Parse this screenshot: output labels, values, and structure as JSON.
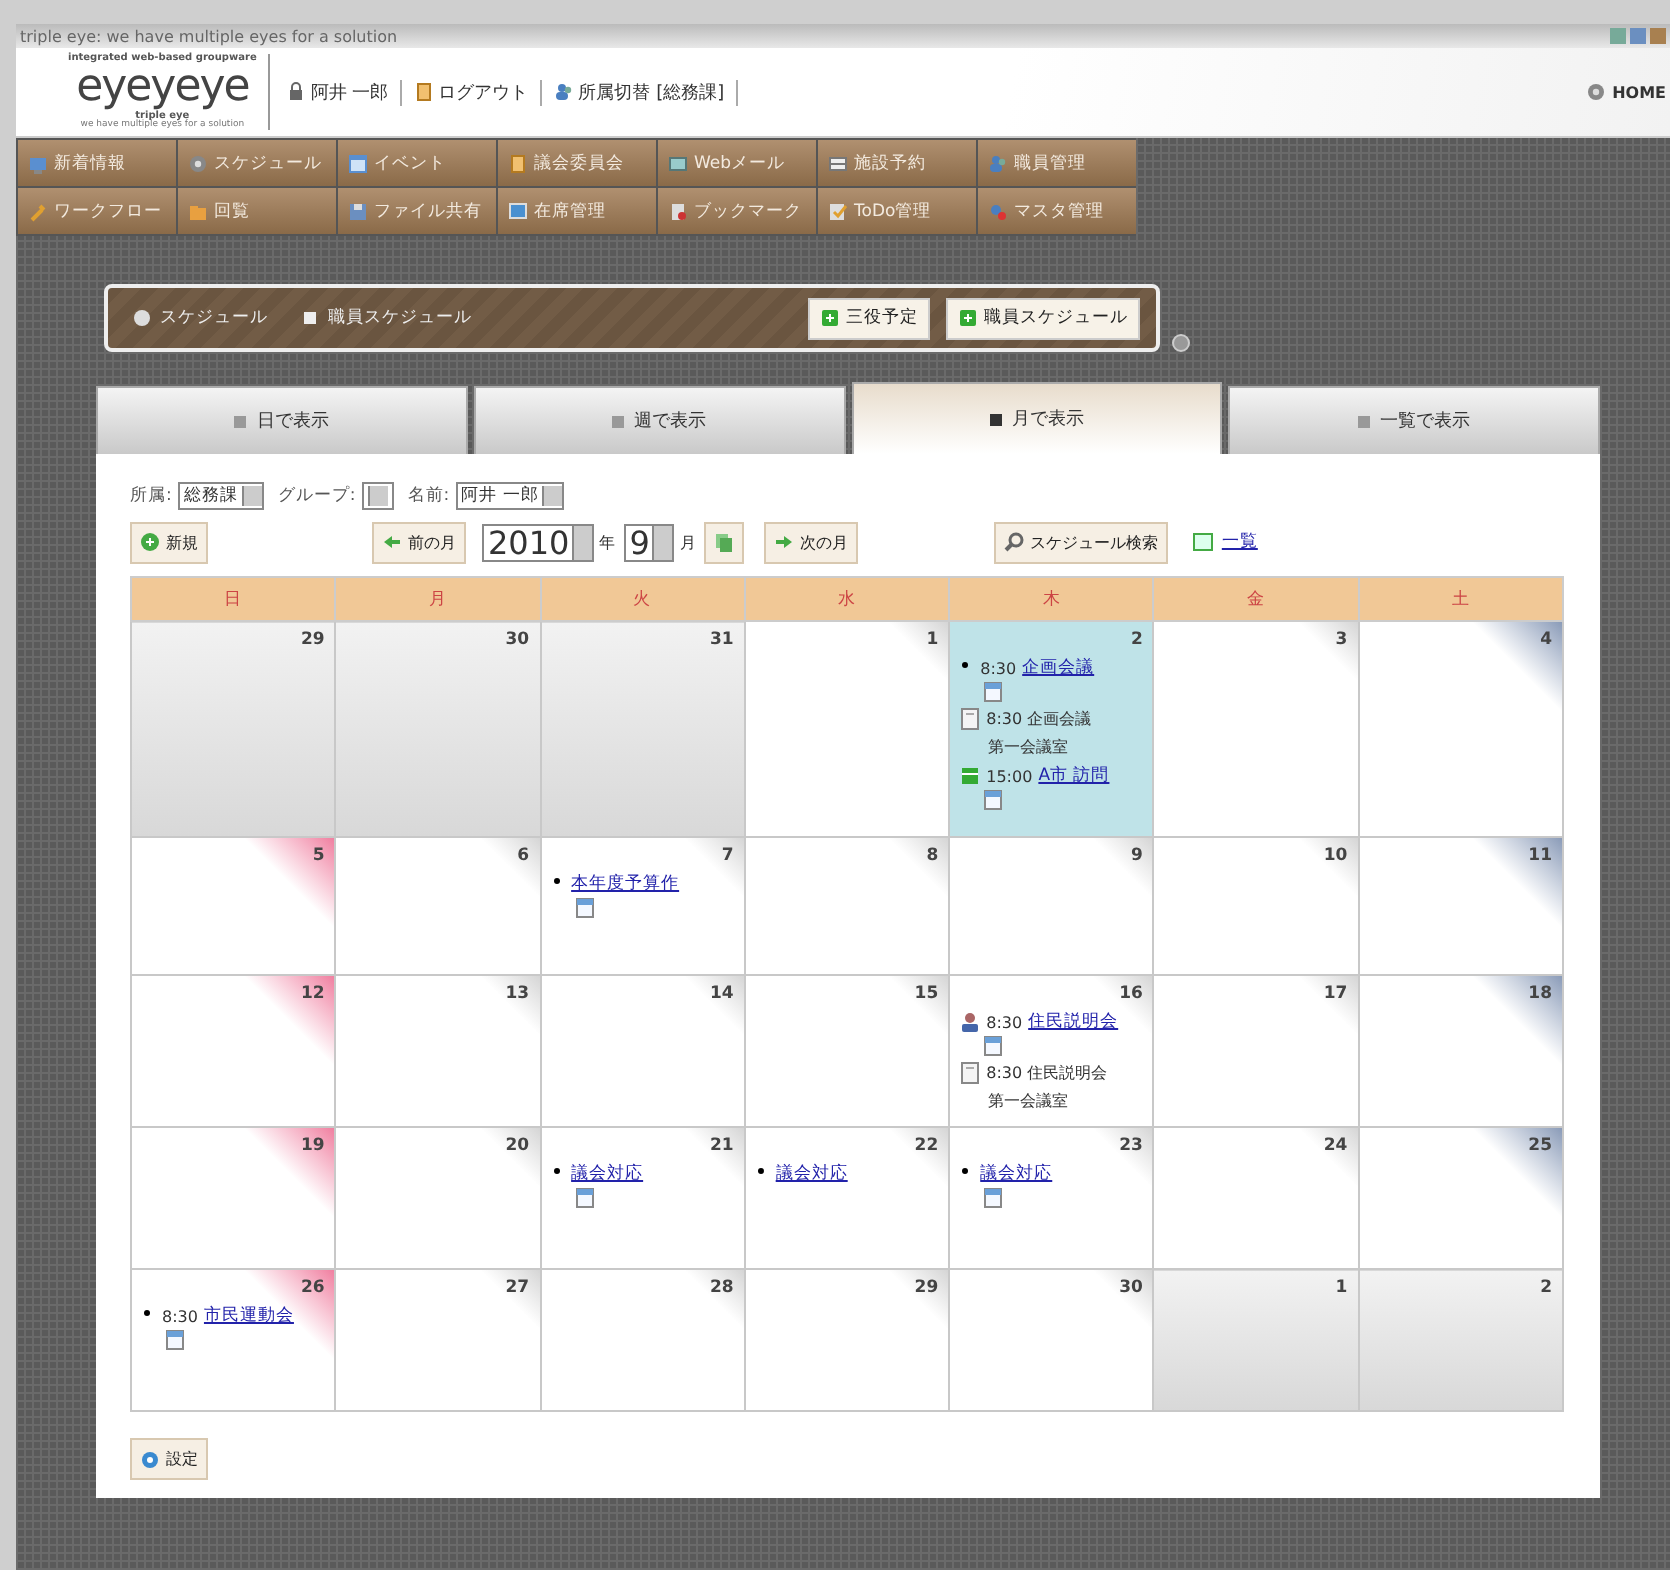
{
  "window": {
    "title": "triple eye: we have multiple eyes for a solution"
  },
  "header": {
    "logo": {
      "tagline_top": "integrated web-based groupware",
      "wordmark": "eyeyeye",
      "name": "triple eye",
      "tagline_bottom": "we have multiple eyes for a solution"
    },
    "user": "阿井 一郎",
    "logout": "ログアウト",
    "switch": "所属切替 [総務課]",
    "home": "HOME"
  },
  "menu": [
    [
      {
        "label": "新着情報"
      },
      {
        "label": "スケジュール"
      },
      {
        "label": "イベント"
      },
      {
        "label": "議会委員会"
      },
      {
        "label": "Webメール"
      },
      {
        "label": "施設予約"
      },
      {
        "label": "職員管理"
      }
    ],
    [
      {
        "label": "ワークフロー"
      },
      {
        "label": "回覧"
      },
      {
        "label": "ファイル共有"
      },
      {
        "label": "在席管理"
      },
      {
        "label": "ブックマーク"
      },
      {
        "label": "ToDo管理"
      },
      {
        "label": "マスタ管理"
      }
    ]
  ],
  "panel": {
    "links": [
      "スケジュール",
      "職員スケジュール"
    ],
    "buttons": [
      "三役予定",
      "職員スケジュール"
    ]
  },
  "tabs": [
    {
      "label": "日で表示",
      "selected": false
    },
    {
      "label": "週で表示",
      "selected": false
    },
    {
      "label": "月で表示",
      "selected": true
    },
    {
      "label": "一覧で表示",
      "selected": false
    }
  ],
  "filters": [
    {
      "label": "所属:",
      "value": "総務課"
    },
    {
      "label": "グループ:"
    },
    {
      "label": "名前:",
      "value": "阿井 一郎"
    }
  ],
  "toolbar": {
    "new": "新規",
    "prev": "前の月",
    "year": "2010",
    "year_unit": "年",
    "month": "9",
    "month_unit": "月",
    "next": "次の月",
    "search": "スケジュール検索",
    "list": "一覧"
  },
  "weekdays": [
    "日",
    "月",
    "火",
    "水",
    "木",
    "金",
    "土"
  ],
  "weeks": [
    [
      {
        "day": "29",
        "other_month": true,
        "highlighted": false
      },
      {
        "day": "30",
        "other_month": true,
        "highlighted": false
      },
      {
        "day": "31",
        "other_month": true,
        "highlighted": false
      },
      {
        "day": "1",
        "other_month": false,
        "highlighted": false
      },
      {
        "day": "2",
        "other_month": false,
        "highlighted": true,
        "events": [
          {
            "kind": "bullet",
            "time": "8:30",
            "title": "企画会議",
            "calendar_icon": true
          },
          {
            "kind": "facility",
            "time": "8:30",
            "title": "企画会議",
            "location": "第一会議室"
          },
          {
            "kind": "visit",
            "time": "15:00",
            "title": "A市 訪問",
            "calendar_icon": true
          }
        ]
      },
      {
        "day": "3",
        "other_month": false,
        "highlighted": false
      },
      {
        "day": "4",
        "other_month": false,
        "highlighted": false
      }
    ],
    [
      {
        "day": "5",
        "other_month": false,
        "highlighted": false
      },
      {
        "day": "6",
        "other_month": false,
        "highlighted": false
      },
      {
        "day": "7",
        "other_month": false,
        "highlighted": false,
        "events": [
          {
            "kind": "bullet",
            "title": "本年度予算作",
            "calendar_icon": true
          }
        ]
      },
      {
        "day": "8",
        "other_month": false,
        "highlighted": false
      },
      {
        "day": "9",
        "other_month": false,
        "highlighted": false
      },
      {
        "day": "10",
        "other_month": false,
        "highlighted": false
      },
      {
        "day": "11",
        "other_month": false,
        "highlighted": false
      }
    ],
    [
      {
        "day": "12",
        "other_month": false,
        "highlighted": false
      },
      {
        "day": "13",
        "other_month": false,
        "highlighted": false
      },
      {
        "day": "14",
        "other_month": false,
        "highlighted": false
      },
      {
        "day": "15",
        "other_month": false,
        "highlighted": false
      },
      {
        "day": "16",
        "other_month": false,
        "highlighted": false,
        "events": [
          {
            "kind": "person",
            "time": "8:30",
            "title": "住民説明会",
            "calendar_icon": true
          },
          {
            "kind": "facility",
            "time": "8:30",
            "title": "住民説明会",
            "location": "第一会議室"
          }
        ]
      },
      {
        "day": "17",
        "other_month": false,
        "highlighted": false
      },
      {
        "day": "18",
        "other_month": false,
        "highlighted": false
      }
    ],
    [
      {
        "day": "19",
        "other_month": false,
        "highlighted": false
      },
      {
        "day": "20",
        "other_month": false,
        "highlighted": false
      },
      {
        "day": "21",
        "other_month": false,
        "highlighted": false,
        "events": [
          {
            "kind": "bullet",
            "title": "議会対応",
            "calendar_icon": true
          }
        ]
      },
      {
        "day": "22",
        "other_month": false,
        "highlighted": false,
        "events": [
          {
            "kind": "bullet",
            "title": "議会対応",
            "calendar_icon": false
          }
        ]
      },
      {
        "day": "23",
        "other_month": false,
        "highlighted": false,
        "events": [
          {
            "kind": "bullet",
            "title": "議会対応",
            "calendar_icon": true
          }
        ]
      },
      {
        "day": "24",
        "other_month": false,
        "highlighted": false
      },
      {
        "day": "25",
        "other_month": false,
        "highlighted": false
      }
    ],
    [
      {
        "day": "26",
        "other_month": false,
        "highlighted": false,
        "events": [
          {
            "kind": "bullet",
            "time": "8:30",
            "title": "市民運動会",
            "calendar_icon": true
          }
        ]
      },
      {
        "day": "27",
        "other_month": false,
        "highlighted": false
      },
      {
        "day": "28",
        "other_month": false,
        "highlighted": false
      },
      {
        "day": "29",
        "other_month": false,
        "highlighted": false
      },
      {
        "day": "30",
        "other_month": false,
        "highlighted": false
      },
      {
        "day": "1",
        "other_month": true,
        "highlighted": false
      },
      {
        "day": "2",
        "other_month": true,
        "highlighted": false
      }
    ]
  ],
  "footer": {
    "settings": "設定"
  }
}
